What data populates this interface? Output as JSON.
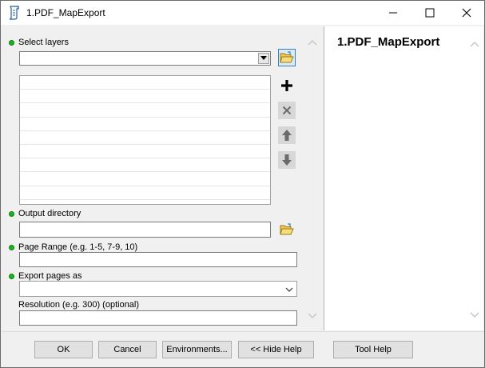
{
  "window": {
    "title": "1.PDF_MapExport",
    "minimize_glyph": "—",
    "maximize_glyph": "☐",
    "close_glyph": "✕"
  },
  "form": {
    "select_layers": {
      "label": "Select  layers",
      "value": "",
      "items": [
        "",
        "",
        "",
        "",
        "",
        "",
        "",
        "",
        ""
      ]
    },
    "output_directory": {
      "label": "Output directory",
      "value": ""
    },
    "page_range": {
      "label": "Page Range (e.g. 1-5, 7-9, 10)",
      "value": ""
    },
    "export_pages_as": {
      "label": "Export pages as",
      "value": ""
    },
    "resolution": {
      "label": "Resolution (e.g. 300) (optional)",
      "value": ""
    }
  },
  "help": {
    "title": "1.PDF_MapExport"
  },
  "buttons": {
    "ok": "OK",
    "cancel": "Cancel",
    "environments": "Environments...",
    "hide_help": "<< Hide Help",
    "tool_help": "Tool Help"
  },
  "icons": {
    "app": "script-tool-icon",
    "browse": "open-folder-icon",
    "add": "plus-icon",
    "remove": "x-icon",
    "move_up": "arrow-up-icon",
    "move_down": "arrow-down-icon"
  },
  "colors": {
    "required_dot": "#1db31d",
    "active_border": "#3c7fb1"
  }
}
